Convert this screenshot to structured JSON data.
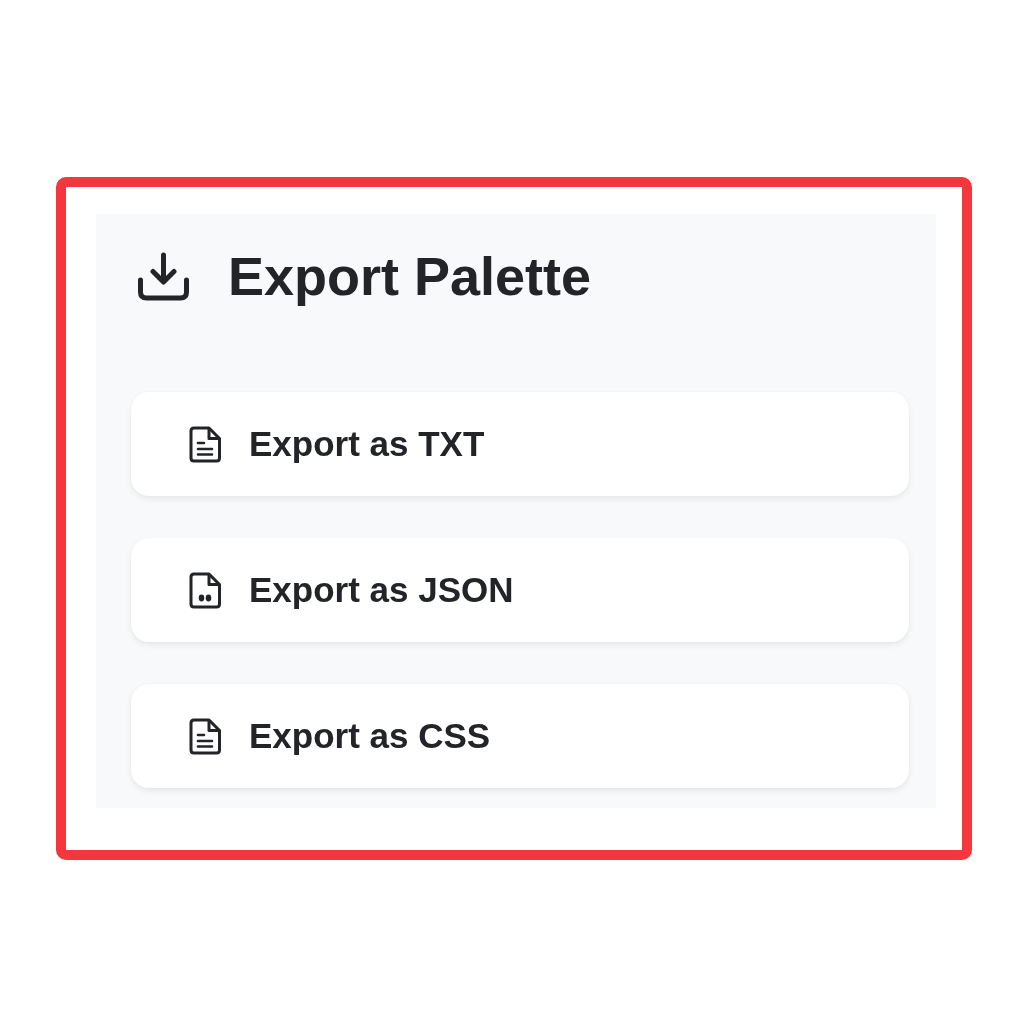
{
  "panel": {
    "title": "Export Palette"
  },
  "options": [
    {
      "label": "Export as TXT",
      "kind": "lines"
    },
    {
      "label": "Export as JSON",
      "kind": "dots"
    },
    {
      "label": "Export as CSS",
      "kind": "lines"
    }
  ]
}
